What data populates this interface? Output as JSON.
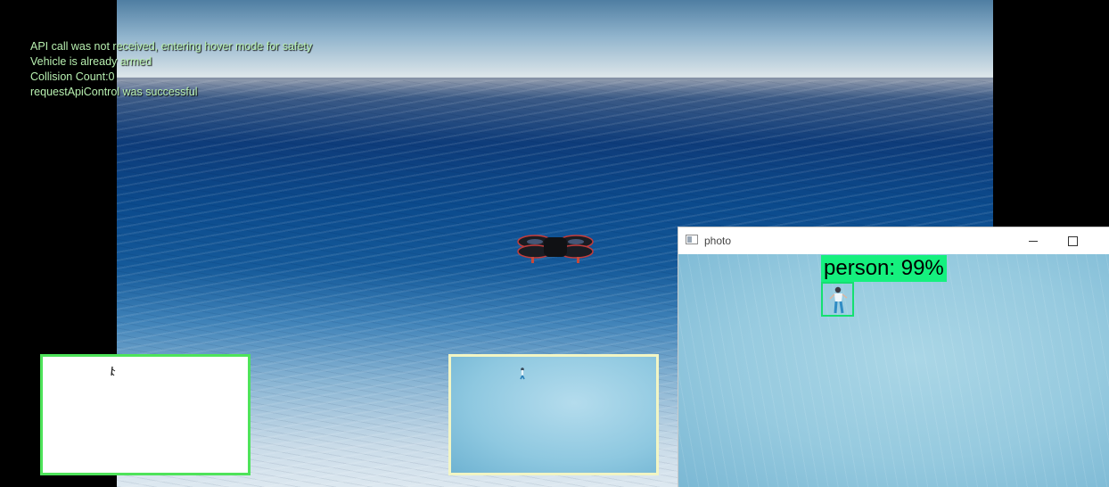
{
  "hud": {
    "lines": [
      "API call was not received, entering hover mode for safety",
      "Vehicle is already armed",
      "Collision Count:0",
      "requestApiControl was successful"
    ]
  },
  "photo_window": {
    "title": "photo",
    "icons": {
      "app": "image-window-icon",
      "minimize": "minimize-icon",
      "maximize": "maximize-icon"
    },
    "detection": {
      "label": "person: 99%",
      "color": "#15f07e"
    }
  },
  "subwindows": {
    "left_border_color": "#4ee35a",
    "middle_border_color": "#f2f5c4"
  }
}
